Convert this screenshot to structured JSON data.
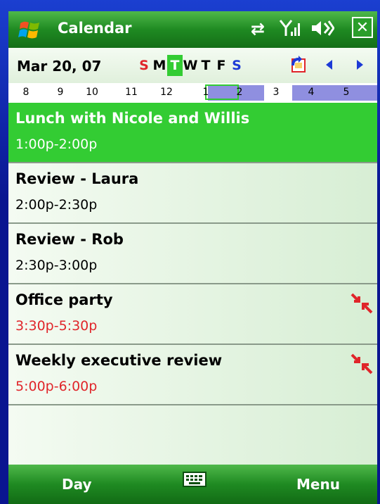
{
  "app": {
    "title": "Calendar"
  },
  "status_icons": [
    "connectivity-icon",
    "signal-icon",
    "volume-icon"
  ],
  "date_bar": {
    "date": "Mar 20, 07",
    "weekdays": [
      {
        "label": "S",
        "kind": "weekend"
      },
      {
        "label": "M",
        "kind": ""
      },
      {
        "label": "T",
        "kind": "today"
      },
      {
        "label": "W",
        "kind": ""
      },
      {
        "label": "T",
        "kind": ""
      },
      {
        "label": "F",
        "kind": ""
      },
      {
        "label": "S",
        "kind": "sat"
      }
    ]
  },
  "hours": [
    "8",
    "9",
    "10",
    "11",
    "12",
    "1",
    "2",
    "3",
    "4",
    "5"
  ],
  "appointments": [
    {
      "title": "Lunch with Nicole and Willis",
      "time": "1:00p-2:00p",
      "selected": true,
      "conflict": false
    },
    {
      "title": "Review - Laura",
      "time": "2:00p-2:30p",
      "selected": false,
      "conflict": false
    },
    {
      "title": "Review - Rob",
      "time": "2:30p-3:00p",
      "selected": false,
      "conflict": false
    },
    {
      "title": "Office party",
      "time": "3:30p-5:30p",
      "selected": false,
      "conflict": true
    },
    {
      "title": "Weekly executive review",
      "time": "5:00p-6:00p",
      "selected": false,
      "conflict": true
    }
  ],
  "menu": {
    "left": "Day",
    "right": "Menu"
  },
  "colors": {
    "accent_green": "#33cc33",
    "conflict_red": "#e0252a",
    "busy_blue": "#8f8fe0"
  }
}
